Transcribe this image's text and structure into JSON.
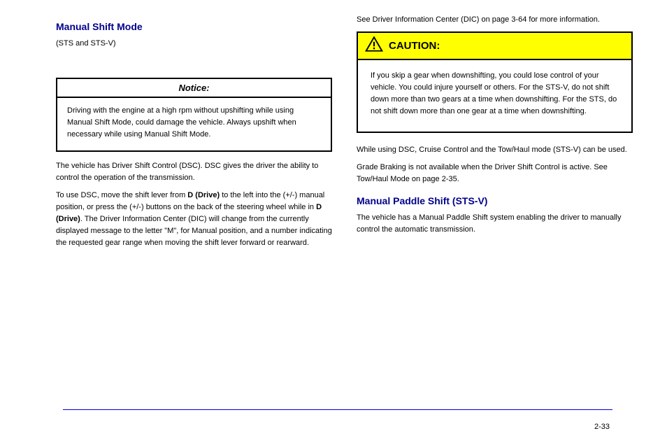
{
  "left": {
    "section_title": "Manual Shift Mode",
    "intro": "(STS and STS-V)",
    "notice_header": "Notice:",
    "notice_body": "Driving with the engine at a high rpm without upshifting while using Manual Shift Mode, could damage the vehicle. Always upshift when necessary while using Manual Shift Mode.",
    "p1": "The vehicle has Driver Shift Control (DSC). DSC gives the driver the ability to control the operation of the transmission.",
    "p2_prefix": "To use DSC, move the shift lever from",
    "p2_d_bold": "D (Drive)",
    "p2_mid": " to the left into the (+/-) manual position, or press the (+/-) buttons on the back of the steering wheel while in ",
    "p2_d_bold2": "D (Drive)",
    "p2_suffix": ". The Driver Information Center (DIC) will change from the currently displayed message to the letter \"M\", for Manual position, and a number indicating the requested gear range when moving the shift lever forward or rearward."
  },
  "right": {
    "p_dsc_info": "See Driver Information Center (DIC) on page 3-64 for more information.",
    "caution_label": "CAUTION:",
    "caution_body": "If you skip a gear when downshifting, you could lose control of your vehicle. You could injure yourself or others. For the STS-V, do not shift down more than two gears at a time when downshifting. For the STS, do not shift down more than one gear at a time when downshifting.",
    "p1": "While using DSC, Cruise Control and the Tow/Haul mode (STS-V) can be used.",
    "p2": "Grade Braking is not available when the Driver Shift Control is active. See Tow/Haul Mode on page 2-35.",
    "heading": "Manual Paddle Shift (STS-V)",
    "p3": "The vehicle has a Manual Paddle Shift system enabling the driver to manually control the automatic transmission."
  },
  "page_number": "2-33"
}
